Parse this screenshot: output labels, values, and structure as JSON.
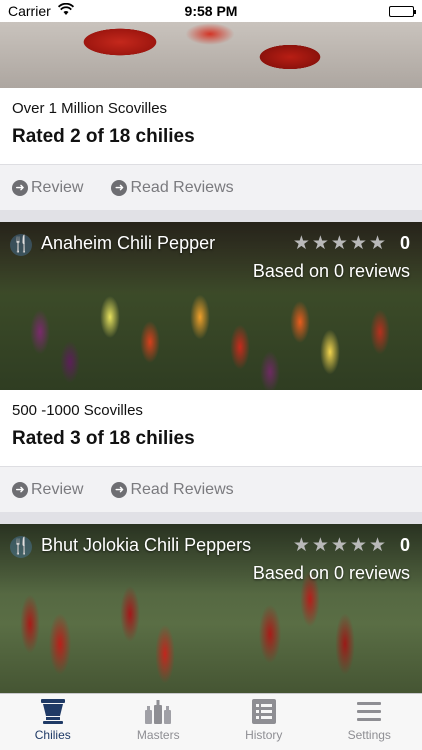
{
  "status_bar": {
    "carrier": "Carrier",
    "time": "9:58 PM"
  },
  "cards": [
    {
      "scoville": "Over 1 Million Scovilles",
      "rated": "Rated 2 of 18 chilies",
      "review_label": "Review",
      "read_reviews_label": "Read Reviews"
    },
    {
      "name": "Anaheim Chili Pepper",
      "rating": "0",
      "stars_filled": 0,
      "stars_total": 5,
      "reviews_text": "Based on 0 reviews",
      "scoville": "500 -1000 Scovilles",
      "rated": "Rated 3 of 18 chilies",
      "review_label": "Review",
      "read_reviews_label": "Read Reviews"
    },
    {
      "name": "Bhut Jolokia Chili Peppers",
      "rating": "0",
      "stars_filled": 0,
      "stars_total": 5,
      "reviews_text": "Based on 0 reviews"
    }
  ],
  "tab_bar": {
    "tabs": [
      {
        "label": "Chilies",
        "icon": "mortar-icon",
        "active": true
      },
      {
        "label": "Masters",
        "icon": "bottles-icon",
        "active": false
      },
      {
        "label": "History",
        "icon": "list-icon",
        "active": false
      },
      {
        "label": "Settings",
        "icon": "menu-icon",
        "active": false
      }
    ]
  },
  "colors": {
    "active_tab": "#1f3a66",
    "inactive_tab": "#8e8e93",
    "star_empty": "#b9b9b9"
  }
}
